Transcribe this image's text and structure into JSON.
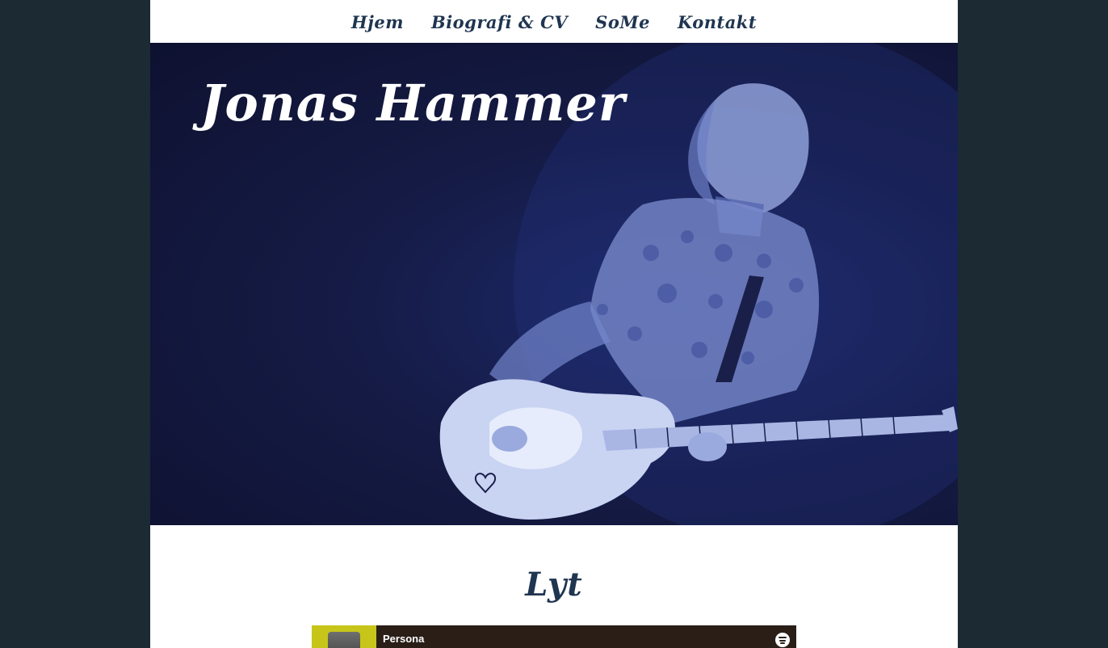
{
  "nav": {
    "items": [
      {
        "label": "Hjem"
      },
      {
        "label": "Biografi & CV"
      },
      {
        "label": "SoMe"
      },
      {
        "label": "Kontakt"
      }
    ]
  },
  "hero": {
    "title": "Jonas Hammer"
  },
  "listen": {
    "heading": "Lyt",
    "player": {
      "track_title": "Persona",
      "brand_icon": "spotify-icon"
    }
  },
  "colors": {
    "page_background": "#1b2a33",
    "nav_text": "#1f3550",
    "hero_tint": "#151b45",
    "player_background": "#2a1e17",
    "cover_accent": "#c7c51a"
  }
}
